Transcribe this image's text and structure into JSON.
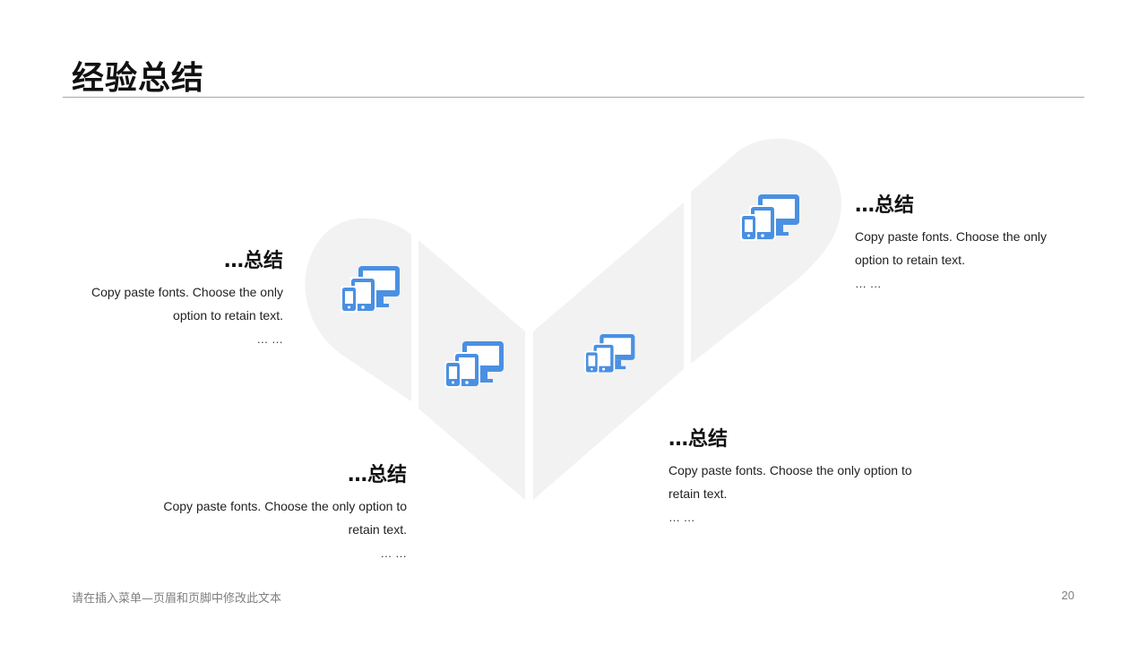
{
  "slide": {
    "title": "经验总结",
    "accent_color": "#4a90e2",
    "shape_color": "#f2f2f2"
  },
  "items": [
    {
      "heading": "…总结",
      "body_line1": "Copy paste fonts. Choose the only",
      "body_line2": "option to retain text.",
      "more": "… …",
      "icon": "devices-icon"
    },
    {
      "heading": "…总结",
      "body_line1": "Copy paste fonts. Choose the only option to",
      "body_line2": "retain text.",
      "more": "… …",
      "icon": "devices-icon"
    },
    {
      "heading": "…总结",
      "body_line1": "Copy paste fonts. Choose the only option to",
      "body_line2": "retain text.",
      "more": "… …",
      "icon": "devices-icon"
    },
    {
      "heading": "…总结",
      "body_line1": "Copy paste fonts. Choose the only",
      "body_line2": "option to retain text.",
      "more": "… …",
      "icon": "devices-icon"
    }
  ],
  "footer": {
    "text": "请在插入菜单—页眉和页脚中修改此文本",
    "page_number": "20"
  }
}
